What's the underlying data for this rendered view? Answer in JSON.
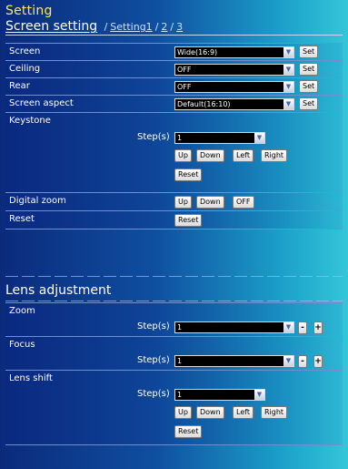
{
  "page_title": "Setting",
  "section": {
    "title": "Screen setting",
    "sep1": "/",
    "link1": "Setting1",
    "sep2": "/",
    "link2": "2",
    "sep3": "/",
    "link3": "3"
  },
  "screen_setting": {
    "screen": {
      "label": "Screen",
      "value": "Wide(16:9)",
      "set": "Set"
    },
    "ceiling": {
      "label": "Ceiling",
      "value": "OFF",
      "set": "Set"
    },
    "rear": {
      "label": "Rear",
      "value": "OFF",
      "set": "Set"
    },
    "aspect": {
      "label": "Screen aspect",
      "value": "Default(16:10)",
      "set": "Set"
    },
    "keystone": {
      "label": "Keystone",
      "steps_label": "Step(s)",
      "steps_value": "1",
      "up": "Up",
      "down": "Down",
      "left": "Left",
      "right": "Right",
      "reset": "Reset"
    },
    "digital_zoom": {
      "label": "Digital zoom",
      "up": "Up",
      "down": "Down",
      "off": "OFF"
    },
    "reset": {
      "label": "Reset",
      "button": "Reset"
    }
  },
  "lens": {
    "title": "Lens adjustment",
    "zoom": {
      "label": "Zoom",
      "steps_label": "Step(s)",
      "steps_value": "1",
      "minus": "-",
      "plus": "+"
    },
    "focus": {
      "label": "Focus",
      "steps_label": "Step(s)",
      "steps_value": "1",
      "minus": "-",
      "plus": "+"
    },
    "shift": {
      "label": "Lens shift",
      "steps_label": "Step(s)",
      "steps_value": "1",
      "up": "Up",
      "down": "Down",
      "left": "Left",
      "right": "Right",
      "reset": "Reset"
    }
  },
  "icons": {
    "dropdown": "chevron-down-icon"
  },
  "colors": {
    "title": "#ffe85a",
    "select_bg": "#000000"
  }
}
